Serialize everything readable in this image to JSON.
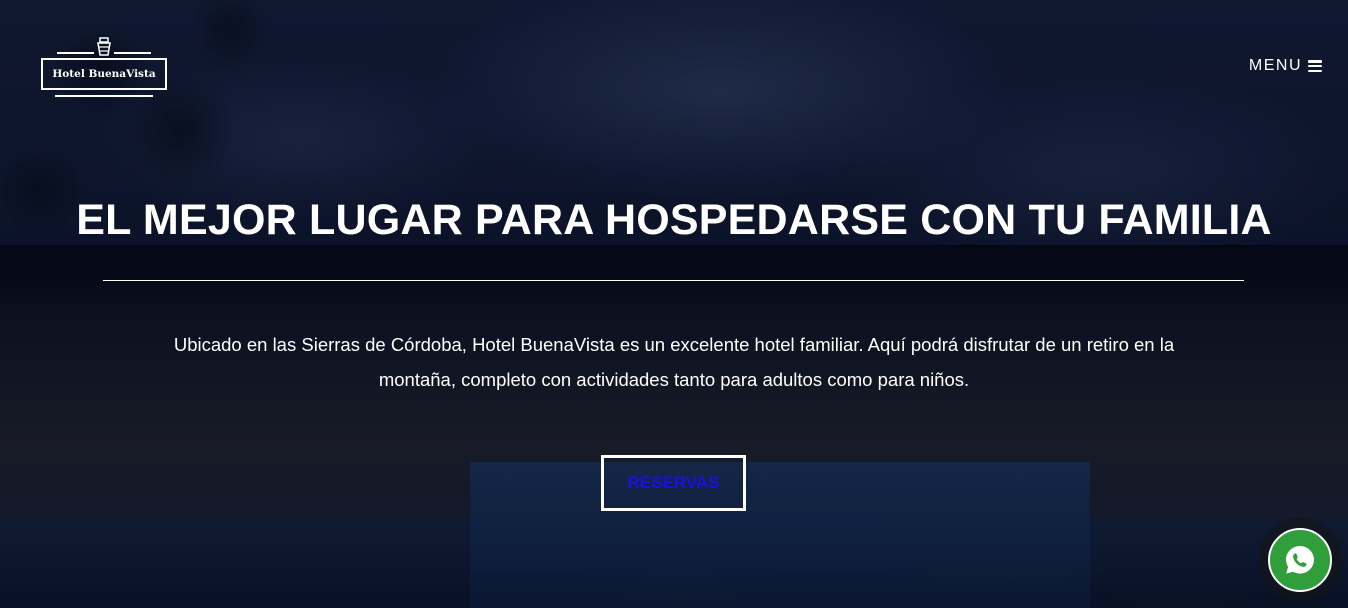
{
  "brand": {
    "name": "Hotel BuenaVista",
    "logo_icon": "lighthouse-icon"
  },
  "nav": {
    "menu_label": "MENU",
    "menu_icon": "hamburger-icon"
  },
  "hero": {
    "headline": "EL MEJOR LUGAR PARA HOSPEDARSE CON TU FAMILIA",
    "description": "Ubicado en las Sierras de Córdoba, Hotel BuenaVista es un excelente hotel familiar. Aquí podrá disfrutar de un retiro en la montaña, completo con actividades tanto para adultos como para niños.",
    "cta_label": "RESERVAS"
  },
  "floating": {
    "whatsapp_icon": "whatsapp-icon"
  },
  "colors": {
    "cta_text": "#1a10e6",
    "whatsapp_green": "#2f9e3b",
    "overlay": "#050a23"
  }
}
